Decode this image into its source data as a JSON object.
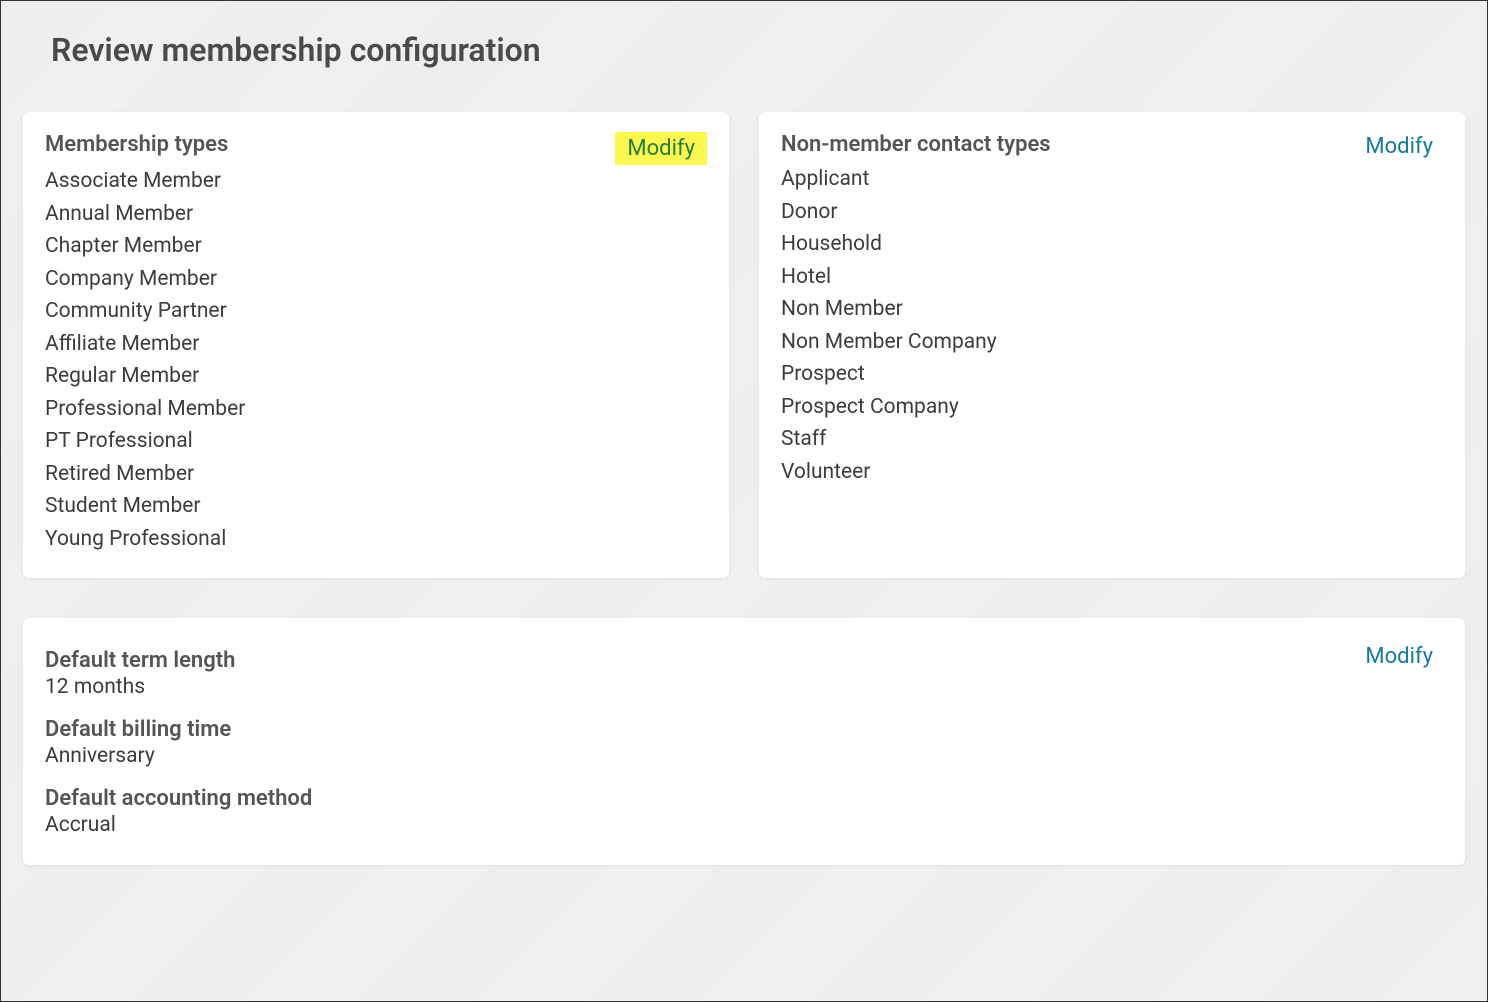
{
  "page": {
    "title": "Review membership configuration"
  },
  "membership_types": {
    "title": "Membership types",
    "modify_label": "Modify",
    "items": [
      "Associate Member",
      "Annual Member",
      "Chapter Member",
      "Company Member",
      "Community Partner",
      "Affiliate Member",
      "Regular Member",
      "Professional Member",
      "PT Professional",
      "Retired Member",
      "Student Member",
      "Young Professional"
    ]
  },
  "non_member_types": {
    "title": "Non-member contact types",
    "modify_label": "Modify",
    "items": [
      "Applicant",
      "Donor",
      "Household",
      "Hotel",
      "Non Member",
      "Non Member Company",
      "Prospect",
      "Prospect Company",
      "Staff",
      "Volunteer"
    ]
  },
  "defaults": {
    "modify_label": "Modify",
    "term_length": {
      "label": "Default term length",
      "value": "12 months"
    },
    "billing_time": {
      "label": "Default billing time",
      "value": "Anniversary"
    },
    "accounting_method": {
      "label": "Default accounting method",
      "value": "Accrual"
    }
  }
}
